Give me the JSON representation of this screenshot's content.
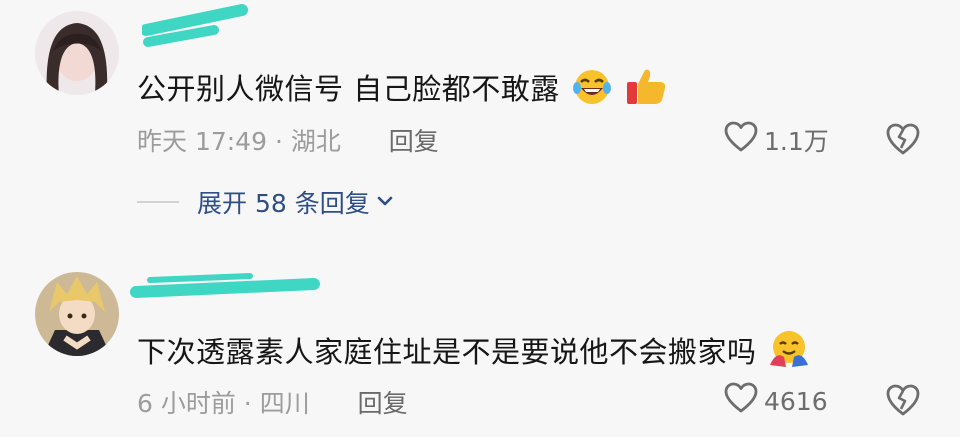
{
  "comments": [
    {
      "text": "公开别人微信号 自己脸都不敢露",
      "emojis": [
        "rolling-laughing-emoji",
        "thumbs-up-emoji"
      ],
      "time_location": "昨天 17:49 · 湖北",
      "reply_label": "回复",
      "likes": "1.1万",
      "expand_replies": "展开 58 条回复"
    },
    {
      "text": "下次透露素人家庭住址是不是要说他不会搬家吗",
      "emojis": [
        "hugging-emoji"
      ],
      "time_location": "6 小时前 · 四川",
      "reply_label": "回复",
      "likes": "4616"
    }
  ],
  "colors": {
    "redaction": "#3fd6c4",
    "text": "#161616",
    "meta": "#9c9c9c",
    "link": "#2f4e86"
  }
}
